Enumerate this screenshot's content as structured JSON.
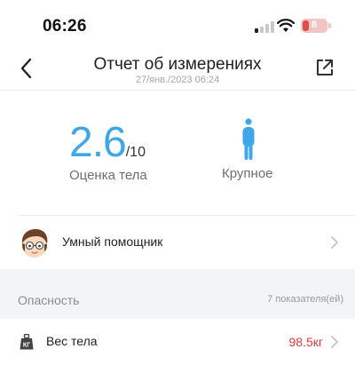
{
  "status_bar": {
    "time": "06:26",
    "battery_level": "8",
    "icons": [
      "cellular-signal-icon",
      "wifi-icon",
      "battery-icon"
    ]
  },
  "header": {
    "title": "Отчет об измерениях",
    "subtitle": "27/янв./2023 06:24",
    "back_icon": "chevron-left-icon",
    "share_icon": "share-icon"
  },
  "score": {
    "value": "2.6",
    "max": "/10",
    "label": "Оценка тела",
    "body_type_label": "Крупное"
  },
  "assistant": {
    "label": "Умный помощник",
    "avatar_icon": "assistant-avatar-icon"
  },
  "danger_section": {
    "title": "Опасность",
    "count": "7 показателя(ей)"
  },
  "weight": {
    "label": "Вес тела",
    "value": "98.5кг",
    "icon_text": "КГ",
    "icon": "weight-scale-icon"
  },
  "colors": {
    "accent_blue": "#3fa7e8",
    "danger_red": "#e53935",
    "section_bg": "#f3f4f6"
  }
}
